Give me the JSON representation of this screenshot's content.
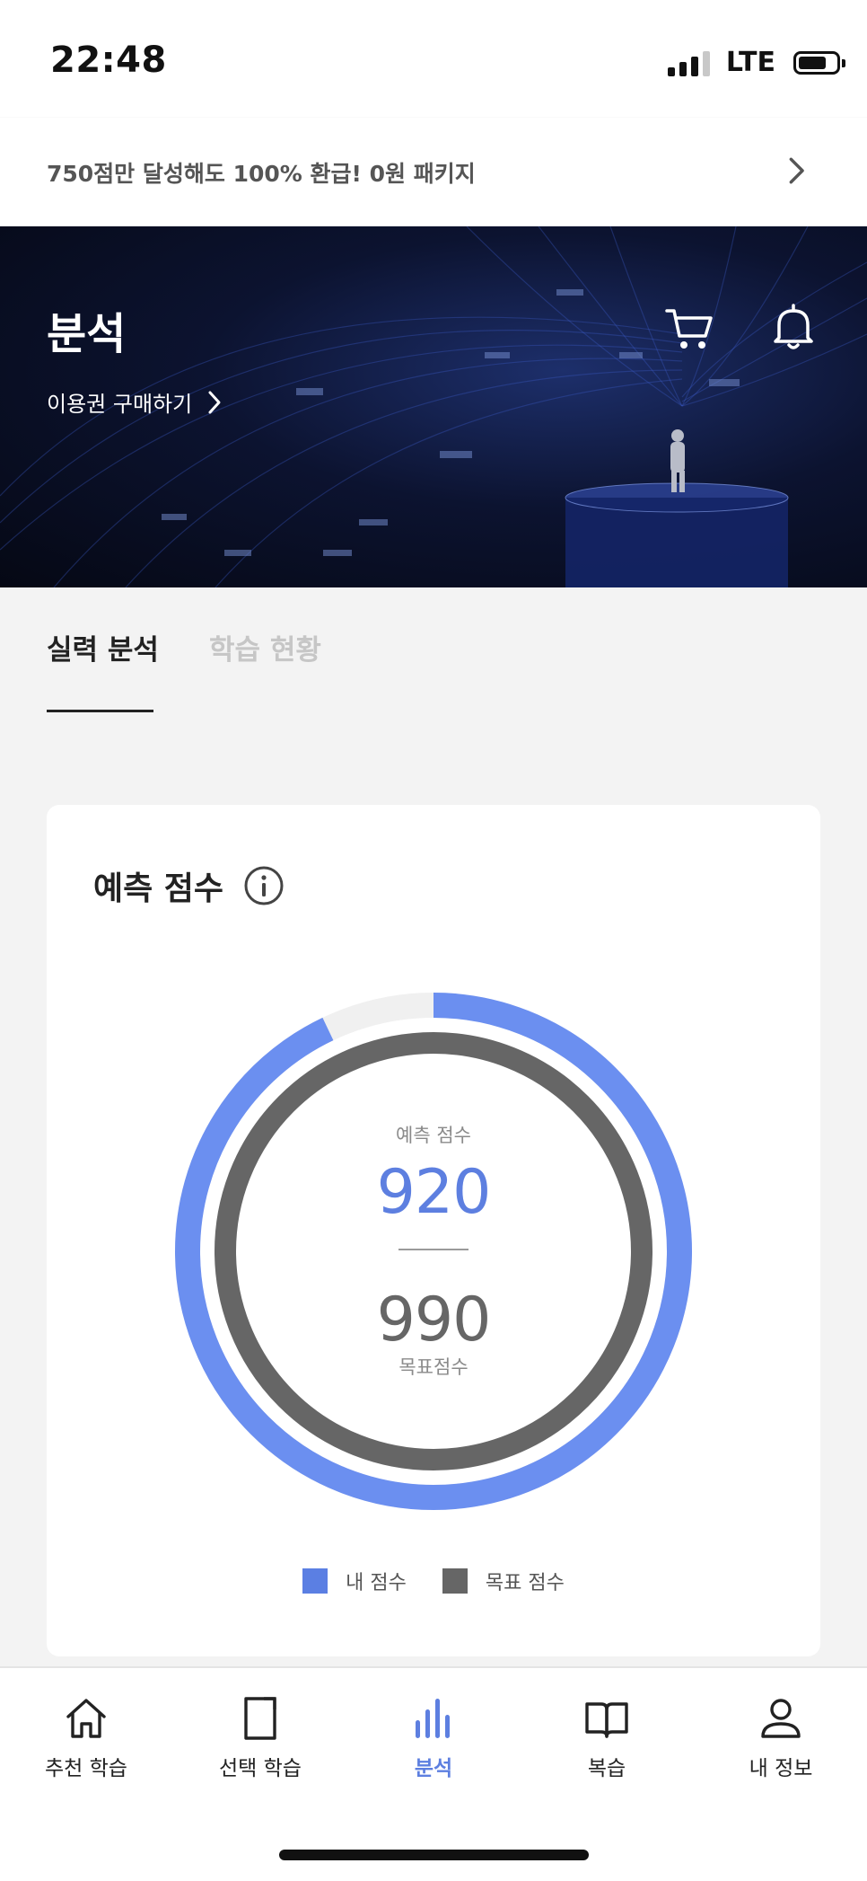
{
  "status_bar": {
    "time": "22:48",
    "network": "LTE"
  },
  "promo": {
    "text": "750점만 달성해도 100% 환급! 0원 패키지"
  },
  "hero": {
    "title": "분석",
    "link_label": "이용권 구매하기"
  },
  "tabs": [
    {
      "label": "실력 분석",
      "active": true
    },
    {
      "label": "학습 현황",
      "active": false
    }
  ],
  "card": {
    "title": "예측 점수",
    "center_top_label": "예측 점수",
    "predicted_score": "920",
    "target_score": "990",
    "center_bottom_label": "목표점수",
    "legend": [
      {
        "label": "내 점수",
        "color": "#5b7fe3"
      },
      {
        "label": "목표 점수",
        "color": "#666666"
      }
    ]
  },
  "chart_data": {
    "type": "pie",
    "title": "예측 점수",
    "series": [
      {
        "name": "내 점수",
        "values": [
          920
        ],
        "max": 990
      },
      {
        "name": "목표 점수",
        "values": [
          990
        ],
        "max": 990
      }
    ]
  },
  "tabbar": {
    "items": [
      {
        "label": "추천 학습",
        "icon": "home-icon"
      },
      {
        "label": "선택 학습",
        "icon": "book-page-icon"
      },
      {
        "label": "분석",
        "icon": "bar-chart-icon",
        "active": true
      },
      {
        "label": "복습",
        "icon": "open-book-icon"
      },
      {
        "label": "내 정보",
        "icon": "user-icon"
      }
    ]
  },
  "colors": {
    "accent": "#5d7fe0",
    "ring_blue": "#6b8ff0",
    "ring_gray": "#666666",
    "ring_track": "#f0f0f0"
  }
}
